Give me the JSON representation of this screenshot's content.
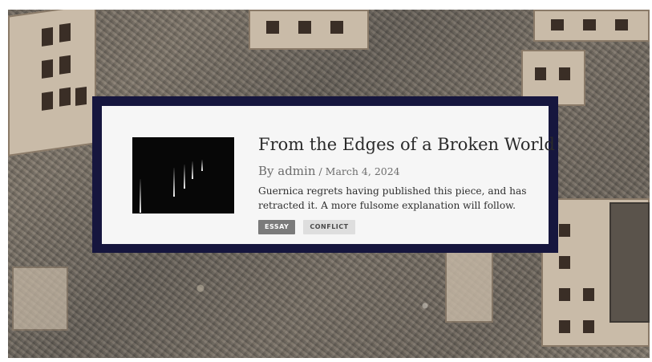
{
  "post": {
    "title": "From the Edges of a Broken World",
    "by_prefix": "By ",
    "author": "admin",
    "date_separator": " / ",
    "date": "March 4, 2024",
    "excerpt": "Guernica regrets having published this piece, and has retracted it. A more fulsome explanation will follow.",
    "tags": [
      "ESSAY",
      "CONFLICT"
    ]
  },
  "colors": {
    "card_border": "#16163e",
    "card_background": "#f6f6f6",
    "tag_primary": "#7b7b7b",
    "tag_secondary": "#dedede"
  },
  "background_image": "aerial-rubble-photo"
}
